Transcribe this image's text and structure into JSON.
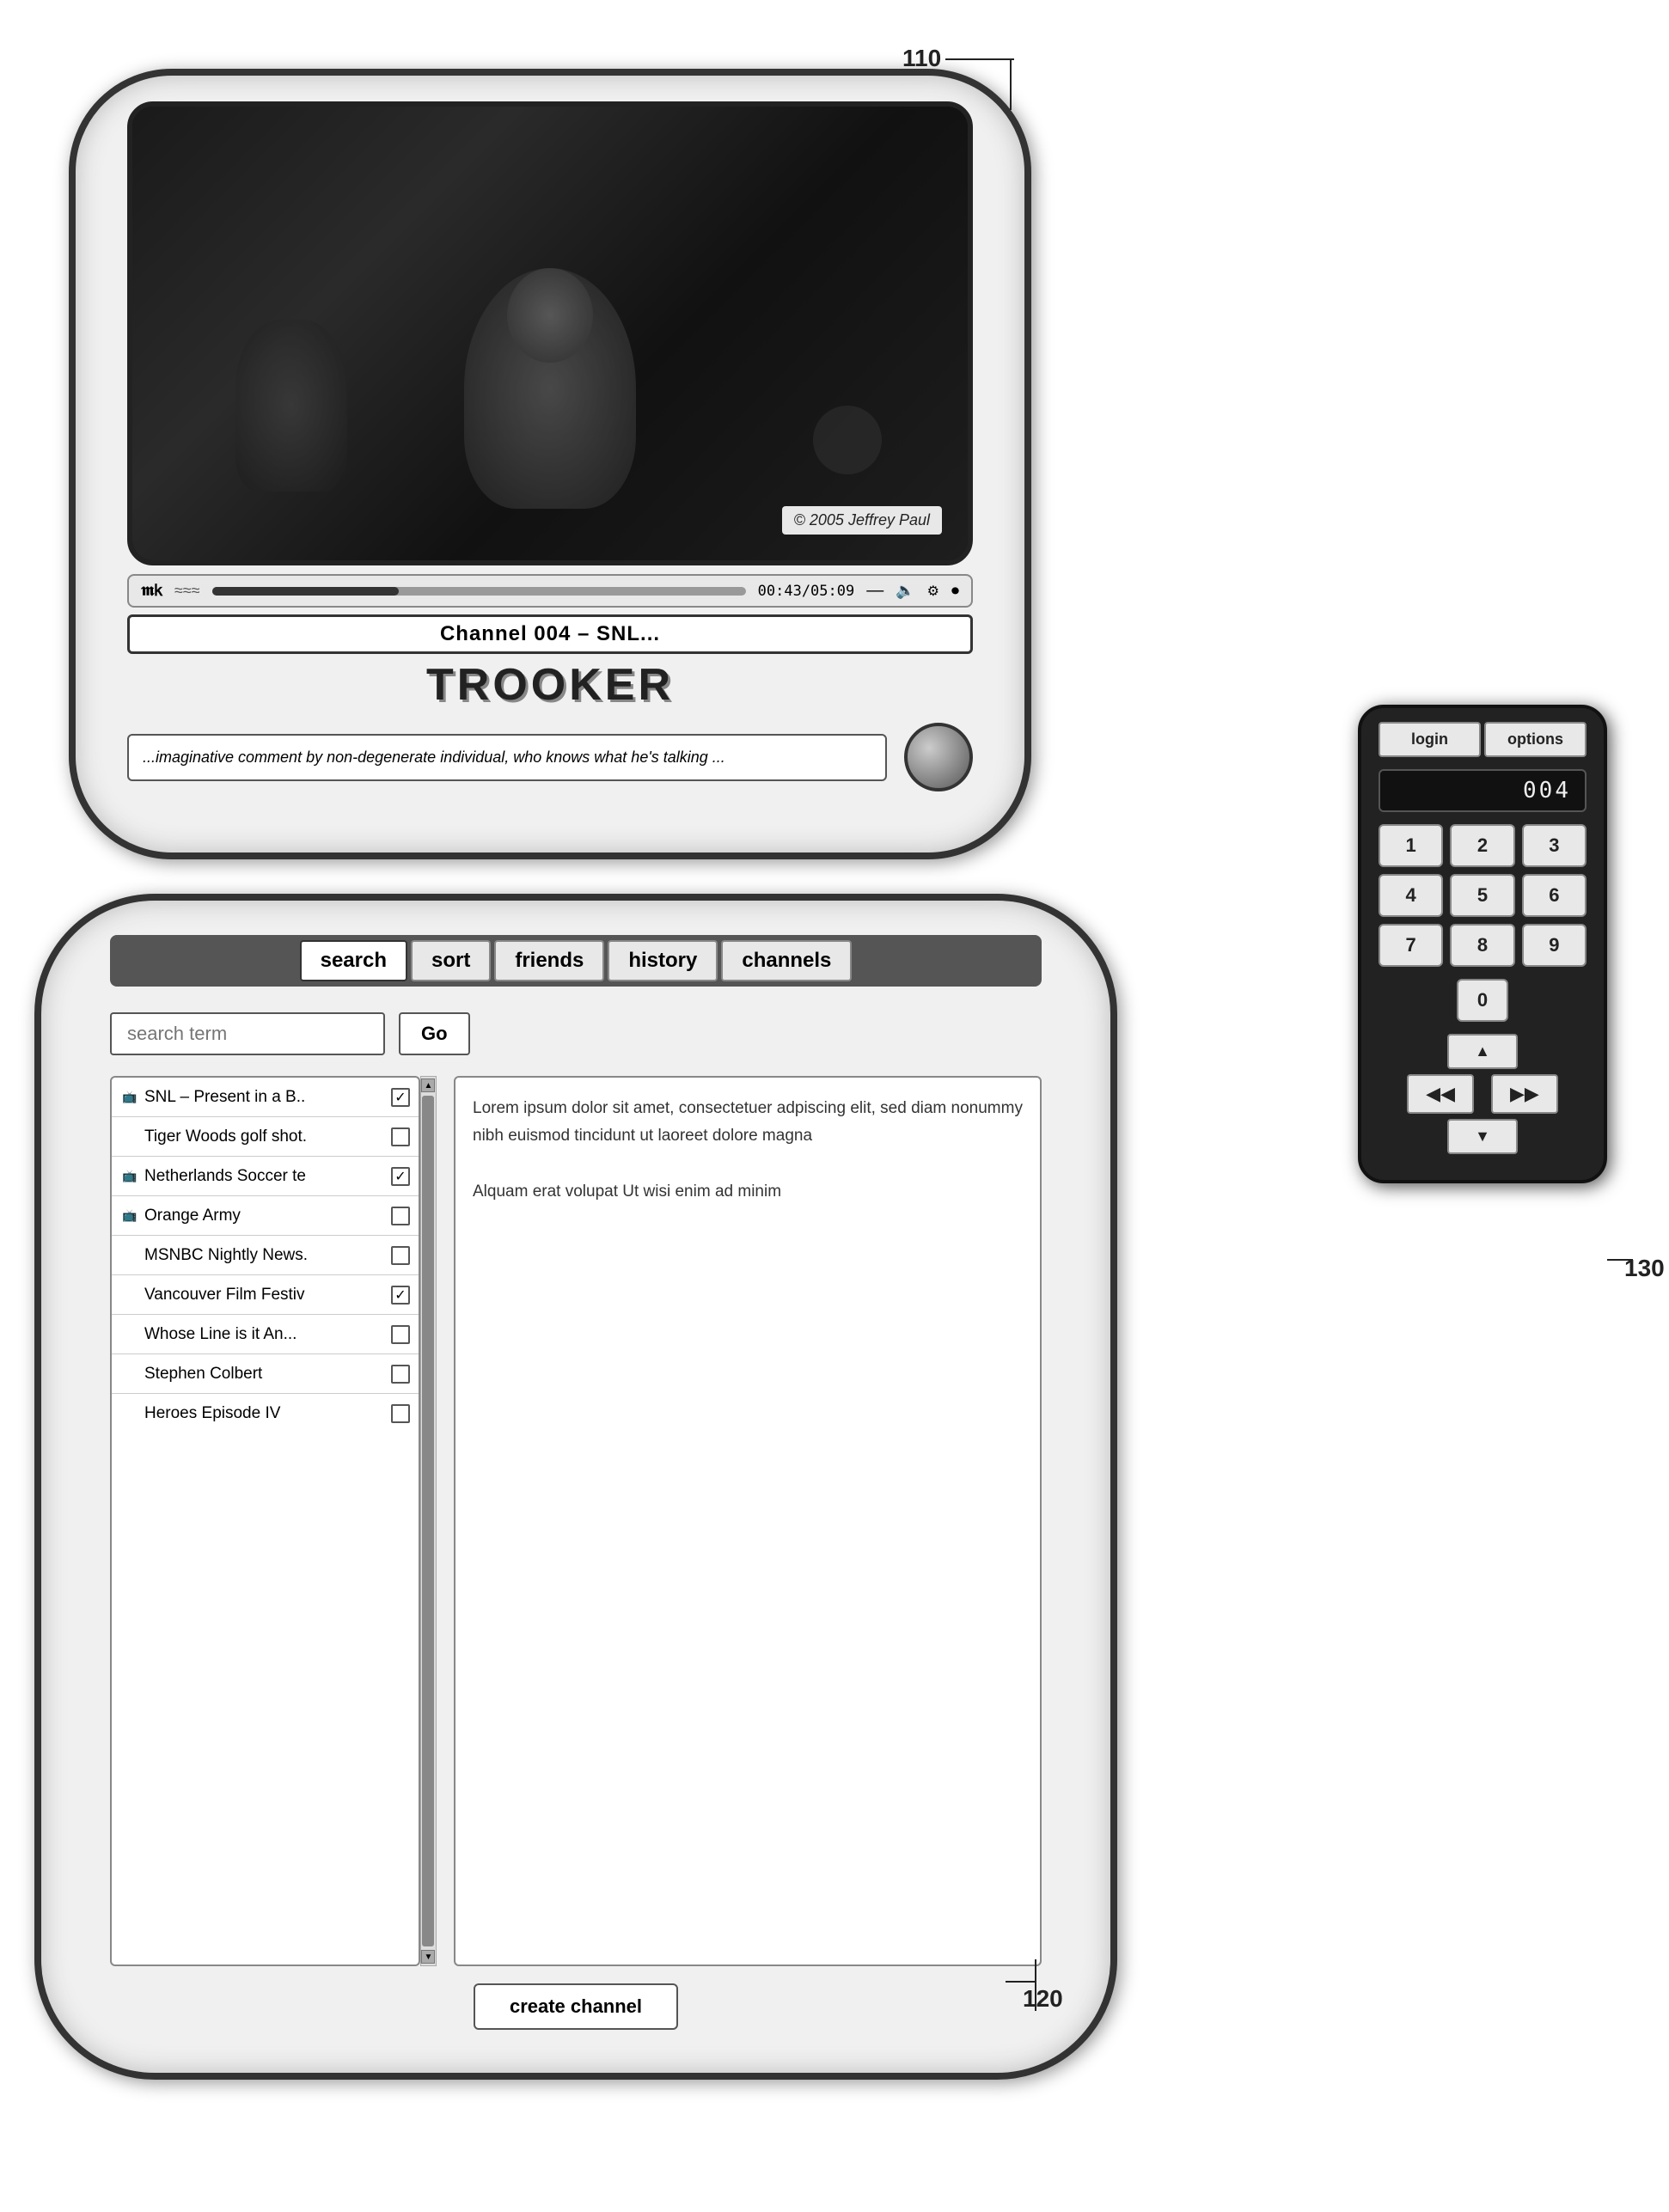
{
  "labels": {
    "ref110": "110",
    "ref120": "120",
    "ref130": "130"
  },
  "tv_upper": {
    "copyright": "© 2005 Jeffrey Paul",
    "time": "00:43/05:09",
    "channel": "Channel 004 – SNL...",
    "brand": "TROOKER",
    "comment": "...imaginative comment by non-degenerate individual, who knows what he's talking ..."
  },
  "remote": {
    "login_label": "login",
    "options_label": "options",
    "channel_display": "004",
    "buttons": [
      "1",
      "2",
      "3",
      "4",
      "5",
      "6",
      "7",
      "8",
      "9",
      "0"
    ],
    "nav_up": "▲",
    "nav_left": "◀◀",
    "nav_right": "▶▶",
    "nav_down": "▼"
  },
  "tv_lower": {
    "tabs": [
      {
        "label": "search",
        "active": true
      },
      {
        "label": "sort",
        "active": false
      },
      {
        "label": "friends",
        "active": false
      },
      {
        "label": "history",
        "active": false
      },
      {
        "label": "channels",
        "active": false
      }
    ],
    "search_placeholder": "search term",
    "go_label": "Go",
    "results": [
      {
        "icon": "tv",
        "label": "SNL – Present in a B..",
        "checked": true
      },
      {
        "icon": "",
        "label": "Tiger Woods golf shot.",
        "checked": false
      },
      {
        "icon": "tv",
        "label": "Netherlands Soccer te",
        "checked": true
      },
      {
        "icon": "tv",
        "label": "Orange Army",
        "checked": false
      },
      {
        "icon": "",
        "label": "MSNBC Nightly News.",
        "checked": false
      },
      {
        "icon": "",
        "label": "Vancouver Film Festiv",
        "checked": true
      },
      {
        "icon": "",
        "label": "Whose Line is it An...",
        "checked": false
      },
      {
        "icon": "",
        "label": "Stephen Colbert",
        "checked": false
      },
      {
        "icon": "",
        "label": "Heroes Episode IV",
        "checked": false
      }
    ],
    "description": "Lorem ipsum dolor sit amet, consectetuer adpiscing elit, sed diam nonummy nibh euismod tincidunt ut laoreet dolore magna\n\nAlquam erat volupat Ut wisi enim ad minim",
    "create_channel_label": "create channel"
  }
}
